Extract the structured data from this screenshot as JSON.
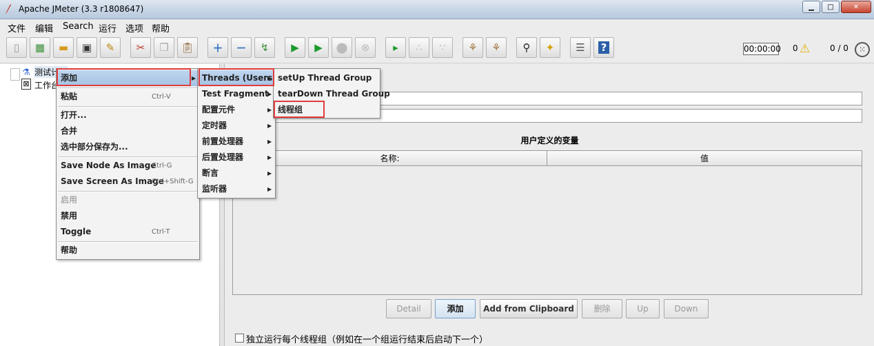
{
  "window": {
    "title": "Apache JMeter (3.3 r1808647)"
  },
  "menubar": [
    "文件",
    "编辑",
    "Search",
    "运行",
    "选项",
    "帮助"
  ],
  "toolbar": {
    "icons": [
      "new-icon",
      "templates-icon",
      "open-icon",
      "save-icon",
      "save-as-icon",
      "cut-icon",
      "copy-icon",
      "paste-icon",
      "expand-icon",
      "collapse-icon",
      "toggle-icon",
      "start-icon",
      "start-no-pause-icon",
      "stop-icon",
      "shutdown-icon",
      "remote-start-icon",
      "remote-stop-icon",
      "remote-shutdown-icon",
      "clear-icon",
      "clear-all-icon",
      "search-icon",
      "reset-search-icon",
      "function-helper-icon",
      "help-icon"
    ],
    "timer": "00:00:00",
    "error_count": "0",
    "threads": "0 / 0"
  },
  "tree": {
    "items": [
      "测试计划",
      "工作台"
    ]
  },
  "panel": {
    "udv_title": "用户定义的变量",
    "col_name": "名称:",
    "col_value": "值",
    "buttons": [
      "Detail",
      "添加",
      "Add from Clipboard",
      "删除",
      "Up",
      "Down"
    ],
    "checkbox_label": "独立运行每个线程组（例如在一个组运行结束后启动下一个）"
  },
  "context_menu": {
    "items": [
      {
        "label": "添加"
      },
      {
        "label": "粘贴",
        "accel": "Ctrl-V"
      },
      {
        "label": "打开..."
      },
      {
        "label": "合并"
      },
      {
        "label": "选中部分保存为..."
      },
      {
        "label": "Save Node As Image",
        "accel": "Ctrl-G"
      },
      {
        "label": "Save Screen As Image",
        "accel": "Ctrl+Shift-G"
      },
      {
        "label": "启用"
      },
      {
        "label": "禁用"
      },
      {
        "label": "Toggle",
        "accel": "Ctrl-T"
      },
      {
        "label": "帮助"
      }
    ]
  },
  "add_submenu": [
    "Threads (Users)",
    "Test Fragment",
    "配置元件",
    "定时器",
    "前置处理器",
    "后置处理器",
    "断言",
    "监听器"
  ],
  "threads_submenu": [
    "setUp Thread Group",
    "tearDown Thread Group",
    "线程组"
  ],
  "colors": {
    "highlight_box": "#e03c3c",
    "selection": "#a5c2e2"
  }
}
